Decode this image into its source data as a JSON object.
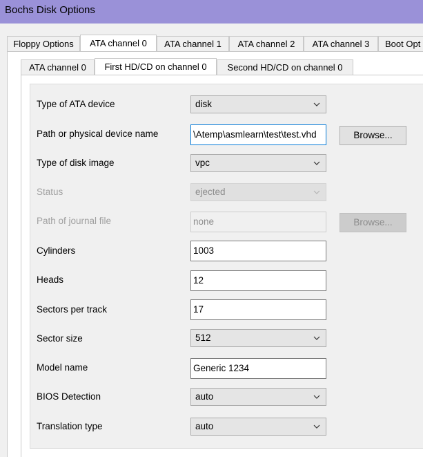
{
  "window": {
    "title": "Bochs Disk Options"
  },
  "main_tabs": [
    {
      "label": "Floppy Options"
    },
    {
      "label": "ATA channel 0"
    },
    {
      "label": "ATA channel 1"
    },
    {
      "label": "ATA channel 2"
    },
    {
      "label": "ATA channel 3"
    },
    {
      "label": "Boot Opt"
    }
  ],
  "sub_tabs": [
    {
      "label": "ATA channel 0"
    },
    {
      "label": "First HD/CD on channel 0"
    },
    {
      "label": "Second HD/CD on channel 0"
    }
  ],
  "form": {
    "type_of_ata_device": {
      "label": "Type of ATA device",
      "value": "disk"
    },
    "path": {
      "label": "Path or physical device name",
      "value": "\\Atemp\\asmlearn\\test\\test.vhd",
      "browse_label": "Browse..."
    },
    "type_of_disk_image": {
      "label": "Type of disk image",
      "value": "vpc"
    },
    "status": {
      "label": "Status",
      "value": "ejected"
    },
    "journal": {
      "label": "Path of journal file",
      "value": "none",
      "browse_label": "Browse..."
    },
    "cylinders": {
      "label": "Cylinders",
      "value": "1003"
    },
    "heads": {
      "label": "Heads",
      "value": "12"
    },
    "sectors_per_track": {
      "label": "Sectors per track",
      "value": "17"
    },
    "sector_size": {
      "label": "Sector size",
      "value": "512"
    },
    "model_name": {
      "label": "Model name",
      "value": "Generic 1234"
    },
    "bios_detection": {
      "label": "BIOS Detection",
      "value": "auto"
    },
    "translation_type": {
      "label": "Translation type",
      "value": "auto"
    }
  },
  "icons": {
    "dropdown_arrow": "chevron-down-icon"
  },
  "colors": {
    "titlebar": "#9a91d8",
    "focus_border": "#0078d7"
  }
}
